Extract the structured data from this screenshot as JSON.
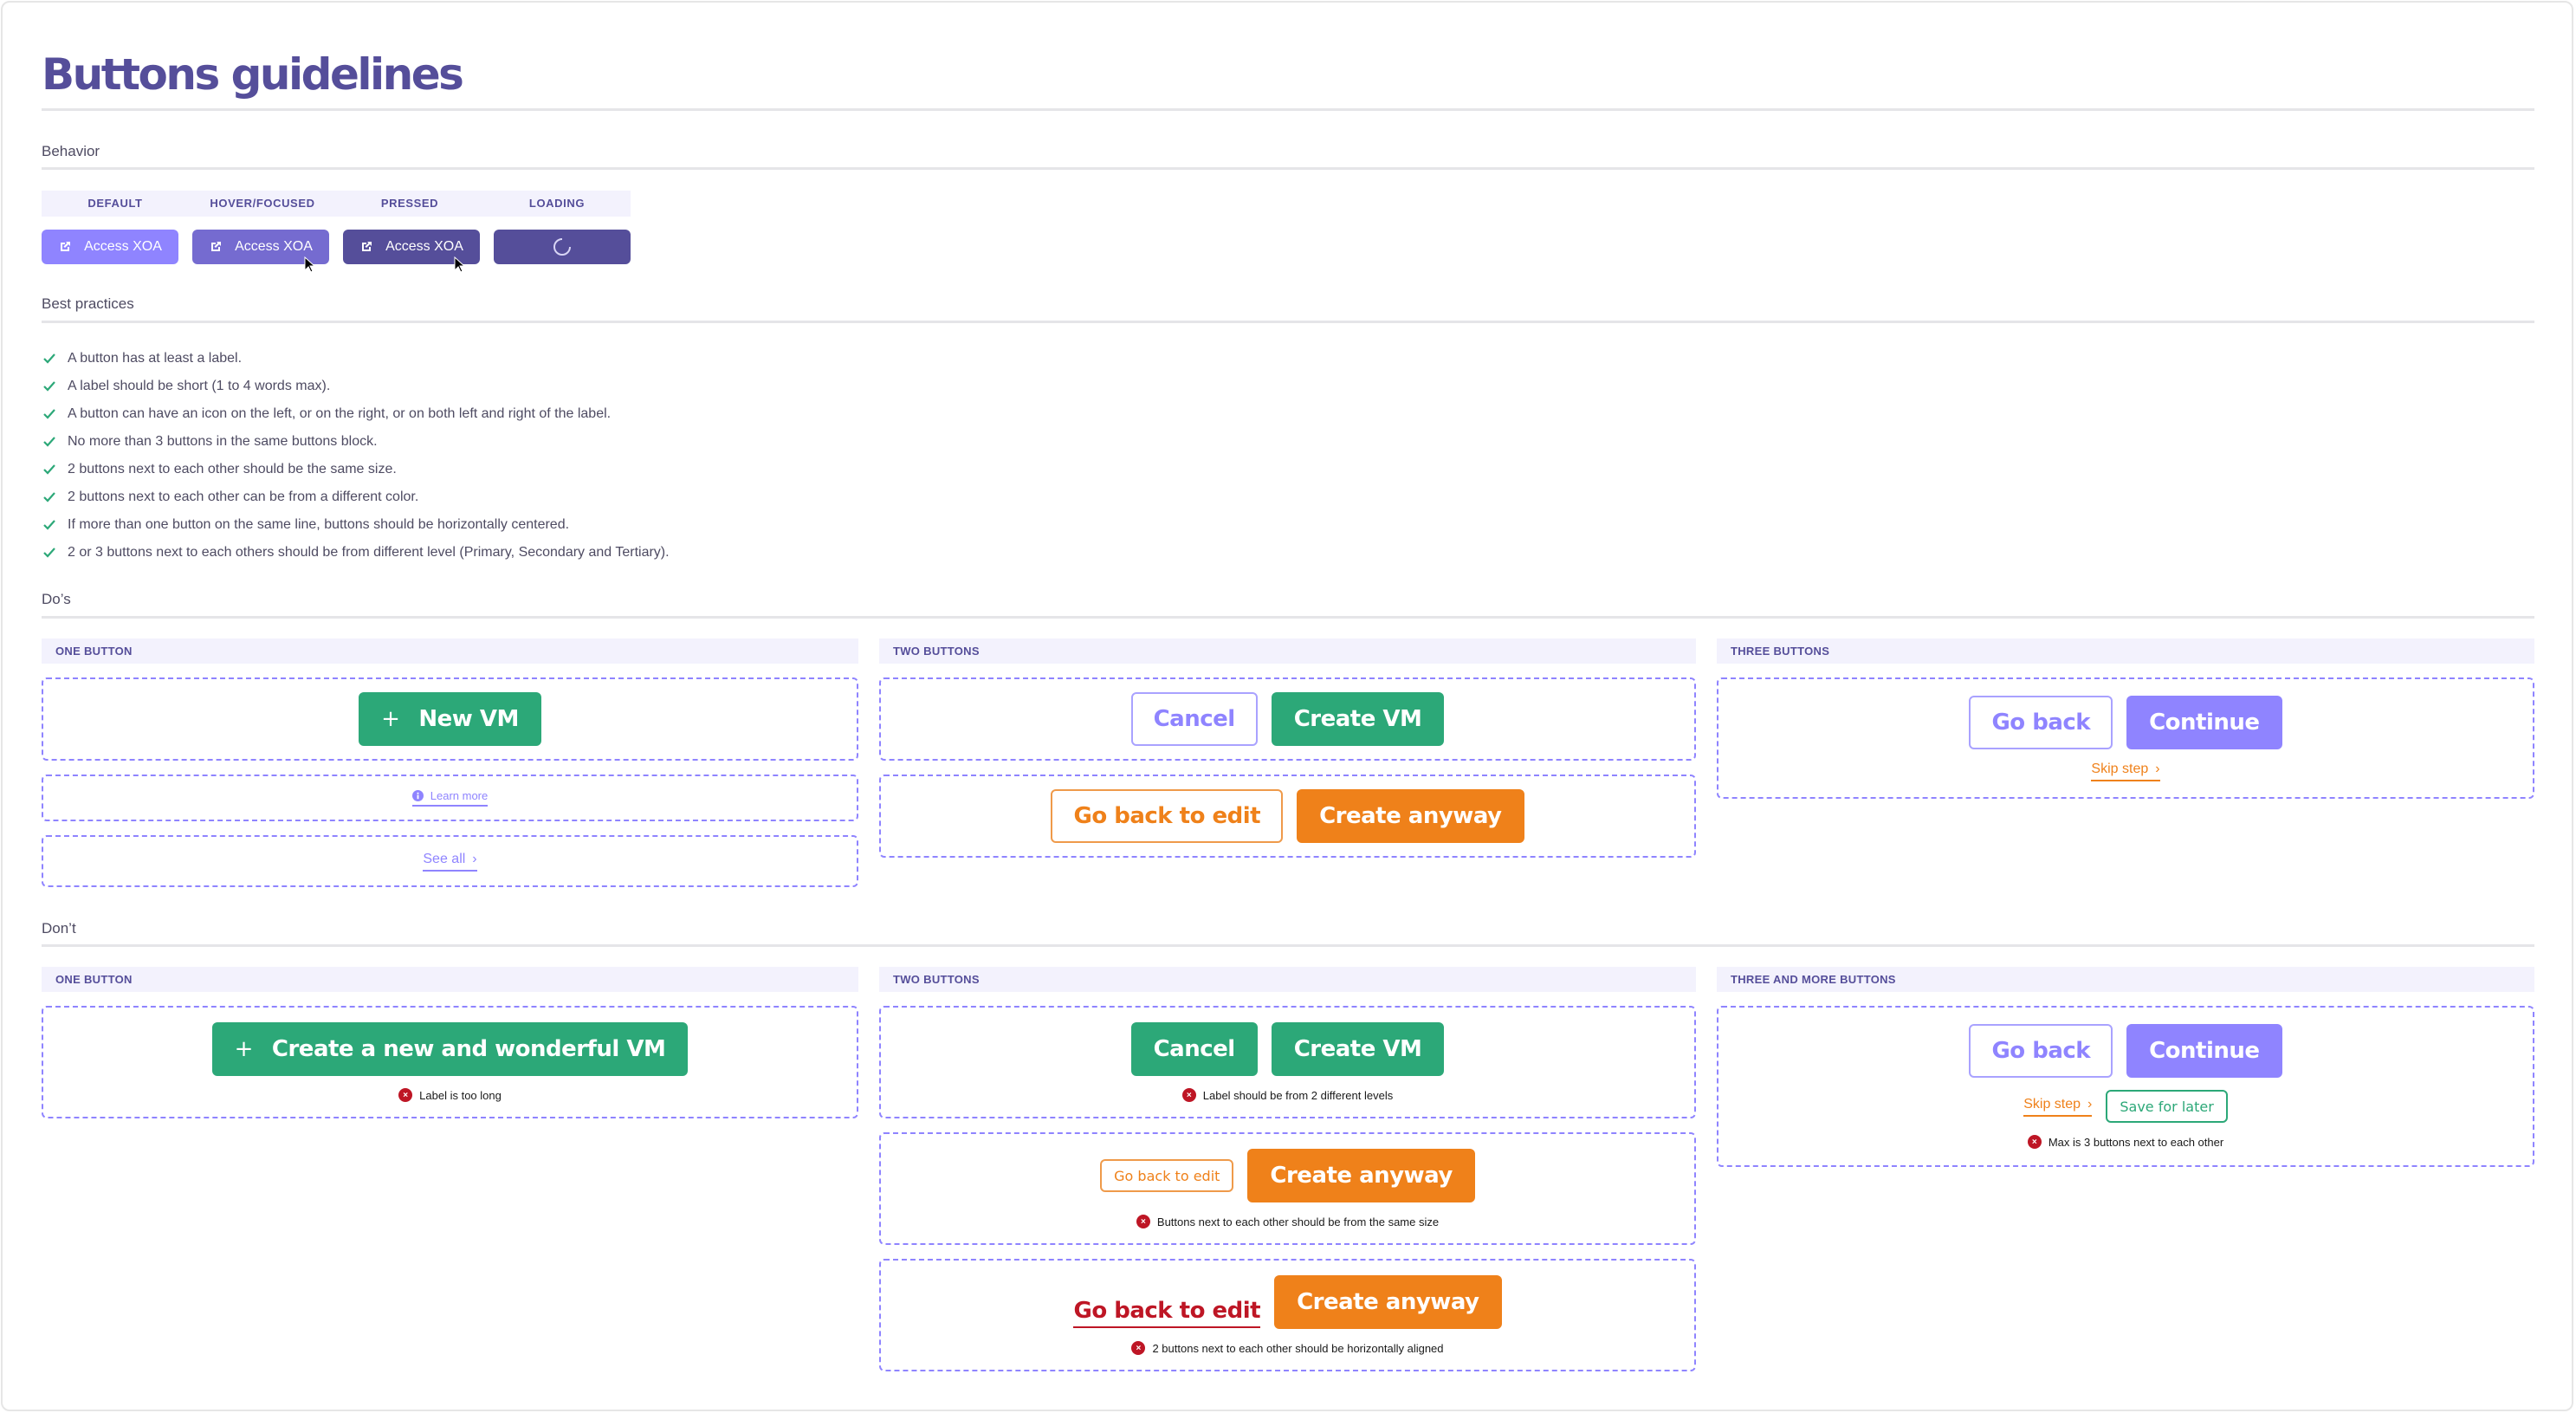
{
  "page": {
    "title": "Buttons guidelines"
  },
  "colors": {
    "primary": "#8f84ff",
    "primary_hover": "#756bd0",
    "primary_pressed": "#554e9a",
    "success": "#2ca878",
    "warning": "#ef811a",
    "danger": "#be1625",
    "heading": "#554e9a"
  },
  "behavior": {
    "section_label": "Behavior",
    "columns": [
      "DEFAULT",
      "HOVER/FOCUSED",
      "PRESSED",
      "LOADING"
    ],
    "buttons": [
      {
        "label": "Access XOA",
        "icon": "external-link-icon",
        "state": "default"
      },
      {
        "label": "Access XOA",
        "icon": "external-link-icon",
        "state": "hover"
      },
      {
        "label": "Access XOA",
        "icon": "external-link-icon",
        "state": "pressed"
      },
      {
        "label": "",
        "icon": "spinner-icon",
        "state": "loading"
      }
    ]
  },
  "best_practices": {
    "section_label": "Best practices",
    "items": [
      "A button has at least a label.",
      "A label should be short (1 to 4 words max).",
      "A button can have an icon on the left, or on the right, or on both left and right of the label.",
      "No more than 3 buttons in the same buttons block.",
      "2 buttons next to each other should be the same size.",
      "2 buttons next to each other can be from a different color.",
      "If more than one button on the same line, buttons should be horizontally centered.",
      "2 or 3 buttons next to each others should be from different level (Primary, Secondary and Tertiary)."
    ]
  },
  "dos": {
    "section_label": "Do’s",
    "one_button": {
      "header": "ONE BUTTON",
      "new_vm": "New VM",
      "learn_more": "Learn more",
      "see_all": "See all"
    },
    "two_buttons": {
      "header": "TWO BUTTONS",
      "cancel": "Cancel",
      "create_vm": "Create VM",
      "go_back_to_edit": "Go back to edit",
      "create_anyway": "Create anyway"
    },
    "three_buttons": {
      "header": "THREE BUTTONS",
      "go_back": "Go back",
      "continue": "Continue",
      "skip_step": "Skip step"
    }
  },
  "donts": {
    "section_label": "Don’t",
    "one_button": {
      "header": "ONE BUTTON",
      "long_label": "Create a new and wonderful VM",
      "error": "Label is too long"
    },
    "two_buttons": {
      "header": "TWO BUTTONS",
      "cancel": "Cancel",
      "create_vm": "Create VM",
      "error1": "Label should be from 2 different levels",
      "go_back_to_edit_small": "Go back to edit",
      "create_anyway_big": "Create anyway",
      "error2": "Buttons next to each other should be from the same size",
      "go_back_to_edit_link": "Go back to edit",
      "create_anyway": "Create anyway",
      "error3": "2 buttons next to each other should be horizontally aligned"
    },
    "three_more_buttons": {
      "header": "THREE AND MORE BUTTONS",
      "go_back": "Go back",
      "continue": "Continue",
      "skip_step": "Skip step",
      "save_for_later": "Save for later",
      "error": "Max is 3 buttons next to each other"
    }
  }
}
